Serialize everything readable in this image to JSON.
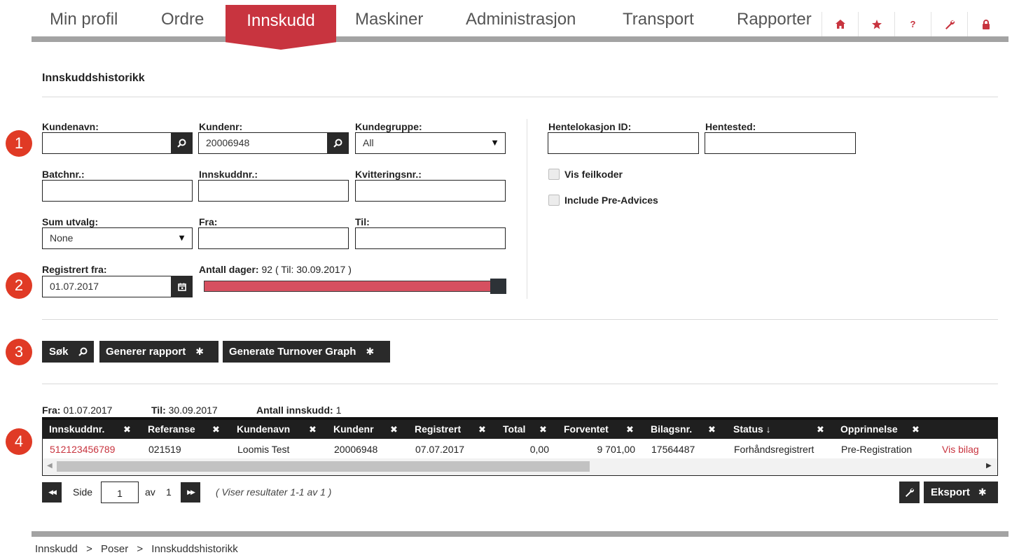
{
  "nav": {
    "tabs": [
      {
        "label": "Min profil"
      },
      {
        "label": "Ordre"
      },
      {
        "label": "Innskudd"
      },
      {
        "label": "Maskiner"
      },
      {
        "label": "Administrasjon"
      },
      {
        "label": "Transport"
      },
      {
        "label": "Rapporter"
      }
    ],
    "icons": [
      "home-icon",
      "star-icon",
      "help-icon",
      "wrench-icon",
      "lock-icon"
    ],
    "accent_color": "#c8343f"
  },
  "page": {
    "title": "Innskuddshistorikk"
  },
  "steps": [
    "1",
    "2",
    "3",
    "4"
  ],
  "form": {
    "kundenavn": {
      "label": "Kundenavn:",
      "value": ""
    },
    "kundenr": {
      "label": "Kundenr:",
      "value": "20006948"
    },
    "kundegruppe": {
      "label": "Kundegruppe:",
      "value": "All"
    },
    "batchnr": {
      "label": "Batchnr.:",
      "value": ""
    },
    "innskuddnr": {
      "label": "Innskuddnr.:",
      "value": ""
    },
    "kvitteringsnr": {
      "label": "Kvitteringsnr.:",
      "value": ""
    },
    "sum_utvalg": {
      "label": "Sum utvalg:",
      "value": "None"
    },
    "fra": {
      "label": "Fra:",
      "value": ""
    },
    "til": {
      "label": "Til:",
      "value": ""
    },
    "registrert_fra": {
      "label": "Registrert fra:",
      "value": "01.07.2017"
    },
    "antall_dager": {
      "label": "Antall dager:",
      "value": "92",
      "til_text": "( Til: 30.09.2017 )",
      "slider_fraction": 1.0
    },
    "hentelokasjon_id": {
      "label": "Hentelokasjon ID:",
      "value": ""
    },
    "hentested": {
      "label": "Hentested:",
      "value": ""
    },
    "vis_feilkoder": {
      "label": "Vis feilkoder",
      "checked": false
    },
    "include_pre_advices": {
      "label": "Include Pre-Advices",
      "checked": false
    }
  },
  "actions": {
    "sok": "Søk",
    "generer_rapport": "Generer rapport",
    "turnover_graph": "Generate Turnover Graph"
  },
  "result_info": {
    "fra_label": "Fra:",
    "fra_value": "01.07.2017",
    "til_label": "Til:",
    "til_value": "30.09.2017",
    "antall_label": "Antall innskudd:",
    "antall_value": "1"
  },
  "table": {
    "columns": [
      "Innskuddnr.",
      "Referanse",
      "Kundenavn",
      "Kundenr",
      "Registrert",
      "Total",
      "Forventet",
      "Bilagsnr.",
      "Status ↓",
      "Opprinnelse"
    ],
    "rows": [
      {
        "innskuddnr": "512123456789",
        "referanse": "021519",
        "kundenavn": "Loomis Test",
        "kundenr": "20006948",
        "registrert": "07.07.2017",
        "total": "0,00",
        "forventet": "9 701,00",
        "bilagsnr": "17564487",
        "status": "Forhåndsregistrert",
        "opprinnelse": "Pre-Registration",
        "link": "Vis bilag"
      }
    ]
  },
  "pager": {
    "side_label": "Side",
    "page": "1",
    "av_label": "av",
    "total_pages": "1",
    "summary": "( Viser resultater 1-1 av 1 )",
    "eksport": "Eksport"
  },
  "breadcrumb": [
    "Innskudd",
    "Poser",
    "Innskuddshistorikk"
  ],
  "breadcrumb_separator": ">"
}
